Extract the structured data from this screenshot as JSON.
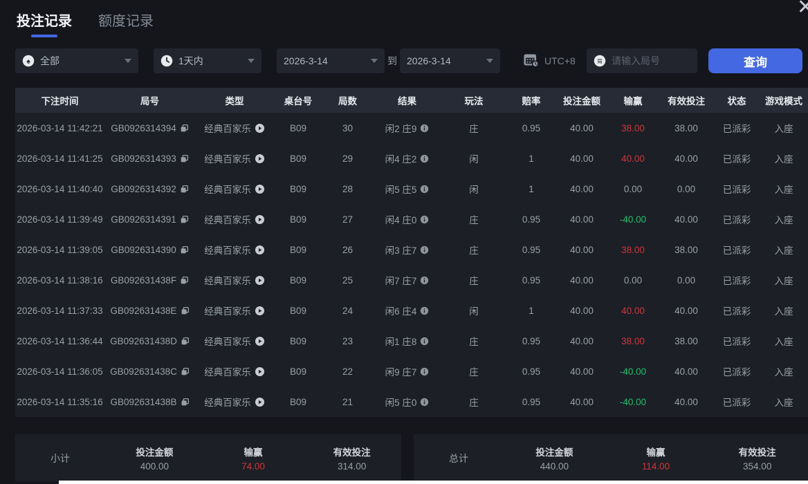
{
  "modal": {
    "close_icon": "✕"
  },
  "tabs": [
    {
      "label": "投注记录",
      "active": true
    },
    {
      "label": "额度记录",
      "active": false
    }
  ],
  "filters": {
    "game_type": {
      "value": "全部",
      "icon": "spade-icon"
    },
    "time_range": {
      "value": "1天内",
      "icon": "clock-icon"
    },
    "date_from": "2026-3-14",
    "to_label": "到",
    "date_to": "2026-3-14",
    "timezone": "UTC+8",
    "search_placeholder": "请输入局号",
    "query_button": "查询"
  },
  "table": {
    "headers": [
      "下注时间",
      "局号",
      "类型",
      "桌台号",
      "局数",
      "结果",
      "玩法",
      "赔率",
      "投注金额",
      "输赢",
      "有效投注",
      "状态",
      "游戏模式"
    ],
    "rows": [
      {
        "time": "2026-03-14 11:42:21",
        "game_id": "GB0926314394",
        "type": "经典百家乐",
        "table_no": "B09",
        "round": "30",
        "result": "闲2 庄9",
        "bet_on": "庄",
        "odds": "0.95",
        "bet_amount": "40.00",
        "win_loss": "38.00",
        "win_loss_tone": "win",
        "valid_bet": "38.00",
        "status": "已派彩",
        "mode": "入座"
      },
      {
        "time": "2026-03-14 11:41:25",
        "game_id": "GB0926314393",
        "type": "经典百家乐",
        "table_no": "B09",
        "round": "29",
        "result": "闲4 庄2",
        "bet_on": "闲",
        "odds": "1",
        "bet_amount": "40.00",
        "win_loss": "40.00",
        "win_loss_tone": "win",
        "valid_bet": "40.00",
        "status": "已派彩",
        "mode": "入座"
      },
      {
        "time": "2026-03-14 11:40:40",
        "game_id": "GB0926314392",
        "type": "经典百家乐",
        "table_no": "B09",
        "round": "28",
        "result": "闲5 庄5",
        "bet_on": "闲",
        "odds": "1",
        "bet_amount": "40.00",
        "win_loss": "0.00",
        "win_loss_tone": "neutral",
        "valid_bet": "0.00",
        "status": "已派彩",
        "mode": "入座"
      },
      {
        "time": "2026-03-14 11:39:49",
        "game_id": "GB0926314391",
        "type": "经典百家乐",
        "table_no": "B09",
        "round": "27",
        "result": "闲4 庄0",
        "bet_on": "庄",
        "odds": "0.95",
        "bet_amount": "40.00",
        "win_loss": "-40.00",
        "win_loss_tone": "loss",
        "valid_bet": "40.00",
        "status": "已派彩",
        "mode": "入座"
      },
      {
        "time": "2026-03-14 11:39:05",
        "game_id": "GB0926314390",
        "type": "经典百家乐",
        "table_no": "B09",
        "round": "26",
        "result": "闲3 庄7",
        "bet_on": "庄",
        "odds": "0.95",
        "bet_amount": "40.00",
        "win_loss": "38.00",
        "win_loss_tone": "win",
        "valid_bet": "38.00",
        "status": "已派彩",
        "mode": "入座"
      },
      {
        "time": "2026-03-14 11:38:16",
        "game_id": "GB092631438F",
        "type": "经典百家乐",
        "table_no": "B09",
        "round": "25",
        "result": "闲7 庄7",
        "bet_on": "庄",
        "odds": "0.95",
        "bet_amount": "40.00",
        "win_loss": "0.00",
        "win_loss_tone": "neutral",
        "valid_bet": "0.00",
        "status": "已派彩",
        "mode": "入座"
      },
      {
        "time": "2026-03-14 11:37:33",
        "game_id": "GB092631438E",
        "type": "经典百家乐",
        "table_no": "B09",
        "round": "24",
        "result": "闲6 庄4",
        "bet_on": "闲",
        "odds": "1",
        "bet_amount": "40.00",
        "win_loss": "40.00",
        "win_loss_tone": "win",
        "valid_bet": "40.00",
        "status": "已派彩",
        "mode": "入座"
      },
      {
        "time": "2026-03-14 11:36:44",
        "game_id": "GB092631438D",
        "type": "经典百家乐",
        "table_no": "B09",
        "round": "23",
        "result": "闲1 庄8",
        "bet_on": "庄",
        "odds": "0.95",
        "bet_amount": "40.00",
        "win_loss": "38.00",
        "win_loss_tone": "win",
        "valid_bet": "38.00",
        "status": "已派彩",
        "mode": "入座"
      },
      {
        "time": "2026-03-14 11:36:05",
        "game_id": "GB092631438C",
        "type": "经典百家乐",
        "table_no": "B09",
        "round": "22",
        "result": "闲9 庄7",
        "bet_on": "庄",
        "odds": "0.95",
        "bet_amount": "40.00",
        "win_loss": "-40.00",
        "win_loss_tone": "loss",
        "valid_bet": "40.00",
        "status": "已派彩",
        "mode": "入座"
      },
      {
        "time": "2026-03-14 11:35:16",
        "game_id": "GB092631438B",
        "type": "经典百家乐",
        "table_no": "B09",
        "round": "21",
        "result": "闲5 庄0",
        "bet_on": "庄",
        "odds": "0.95",
        "bet_amount": "40.00",
        "win_loss": "-40.00",
        "win_loss_tone": "loss",
        "valid_bet": "40.00",
        "status": "已派彩",
        "mode": "入座"
      }
    ]
  },
  "summary": {
    "subtotal": {
      "label": "小计",
      "bet_amount_label": "投注金额",
      "bet_amount": "400.00",
      "win_loss_label": "输赢",
      "win_loss": "74.00",
      "valid_bet_label": "有效投注",
      "valid_bet": "314.00"
    },
    "total": {
      "label": "总计",
      "bet_amount_label": "投注金额",
      "bet_amount": "440.00",
      "win_loss_label": "输赢",
      "win_loss": "114.00",
      "valid_bet_label": "有效投注",
      "valid_bet": "354.00"
    }
  },
  "colors": {
    "accent": "#4468e2",
    "win_red": "#d13539",
    "loss_green": "#1ec068"
  }
}
